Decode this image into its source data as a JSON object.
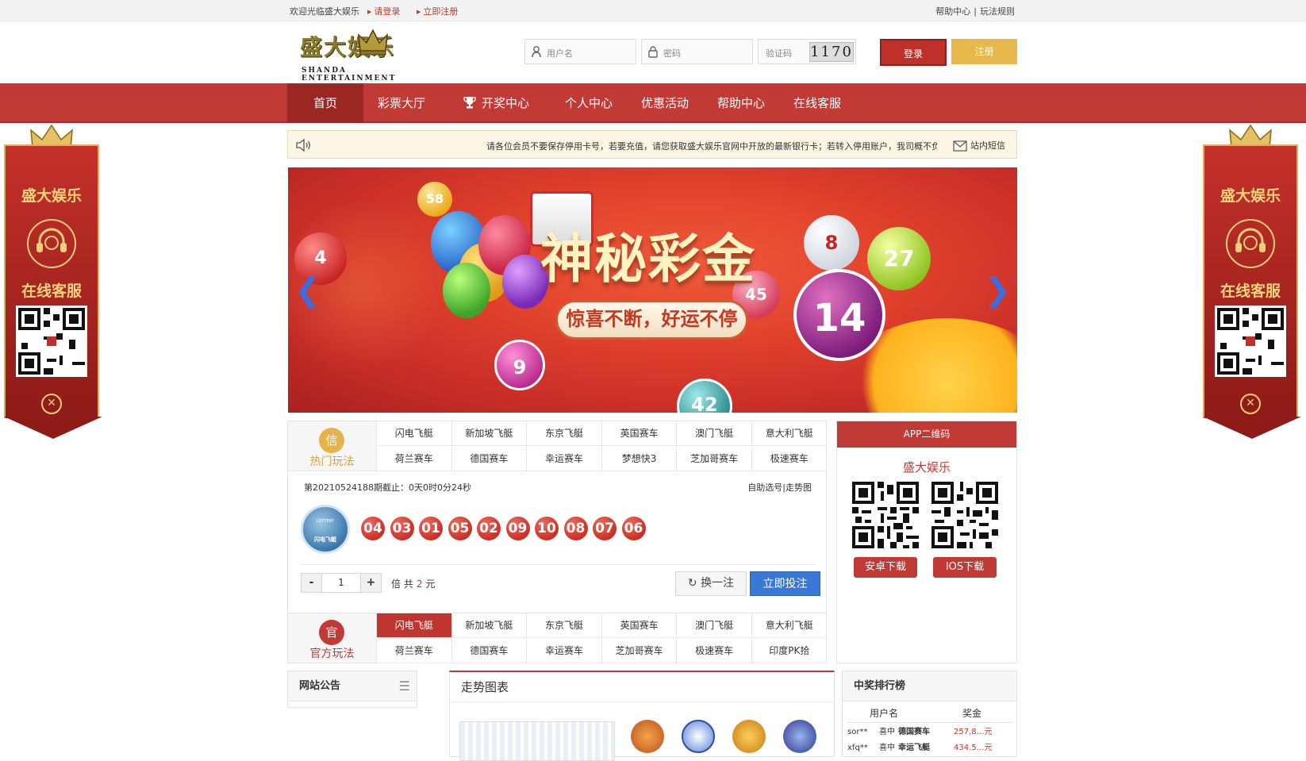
{
  "topbar": {
    "welcome": "欢迎光临盛大娱乐",
    "login_link": "请登录",
    "register_link": "立即注册",
    "help": "帮助中心",
    "sep": "|",
    "rules": "玩法规则"
  },
  "header": {
    "brand": "盛大娱乐",
    "brand_sub": "SHANDA ENTERTAINMENT",
    "username_placeholder": "用户名",
    "password_placeholder": "密码",
    "captcha_placeholder": "验证码",
    "captcha_code": "1170",
    "login_btn": "登录",
    "register_btn": "注册"
  },
  "nav": {
    "items": [
      "首页",
      "彩票大厅",
      "开奖中心",
      "个人中心",
      "优惠活动",
      "帮助中心",
      "在线客服"
    ],
    "active": "首页"
  },
  "notice": {
    "text": "请各位会员不要保存停用卡号，若要充值，请您获取盛大娱乐官网中开放的最新银行卡；若转入停用账户，我司概不负",
    "mail": "站内短信"
  },
  "banner": {
    "title": "神秘彩金",
    "slogan": "惊喜不断，好运不停",
    "balls": [
      "58",
      "4",
      "8",
      "27",
      "45",
      "14",
      "9",
      "42"
    ]
  },
  "hot": {
    "badge": "信",
    "label": "热门玩法",
    "games": [
      "闪电飞艇",
      "新加坡飞艇",
      "东京飞艇",
      "英国赛车",
      "澳门飞艇",
      "意大利飞艇",
      "荷兰赛车",
      "德国赛车",
      "幸运赛车",
      "梦想快3",
      "芝加哥赛车",
      "极速赛车"
    ]
  },
  "draw": {
    "period": "第20210524188期截止：0天0时0分24秒",
    "links": "自助选号|走势图",
    "logo_top": "LOTTERY",
    "logo_name": "闪电飞艇",
    "numbers": [
      "04",
      "03",
      "01",
      "05",
      "02",
      "09",
      "10",
      "08",
      "07",
      "06"
    ],
    "minus": "-",
    "multiplier": "1",
    "plus": "+",
    "info_prefix": "倍 共",
    "amount": "2",
    "info_suffix": "元",
    "change_btn": "换一注",
    "bet_btn": "立即投注"
  },
  "official": {
    "badge": "官",
    "label": "官方玩法",
    "games": [
      "闪电飞艇",
      "新加坡飞艇",
      "东京飞艇",
      "英国赛车",
      "澳门飞艇",
      "意大利飞艇",
      "荷兰赛车",
      "德国赛车",
      "幸运赛车",
      "芝加哥赛车",
      "极速赛车",
      "印度PK拾"
    ],
    "selected": "闪电飞艇"
  },
  "app": {
    "header": "APP二维码",
    "name": "盛大娱乐",
    "android": "安卓下载",
    "ios": "IOS下载"
  },
  "panels": {
    "site_notice": "网站公告",
    "trend": "走势图表",
    "ranking": "中奖排行榜",
    "col_user": "用户名",
    "col_prize": "奖金",
    "rows": [
      {
        "user": "sor**",
        "won": "喜中",
        "game": "德国赛车",
        "prize": "257,8…元"
      },
      {
        "user": "xfq**",
        "won": "喜中",
        "game": "幸运飞艇",
        "prize": "434.5…元"
      }
    ]
  },
  "side": {
    "brand": "盛大娱乐",
    "service": "在线客服"
  },
  "colors": {
    "primary_red": "#c23a36",
    "gold": "#e7b84b",
    "blue": "#3a78d6"
  }
}
